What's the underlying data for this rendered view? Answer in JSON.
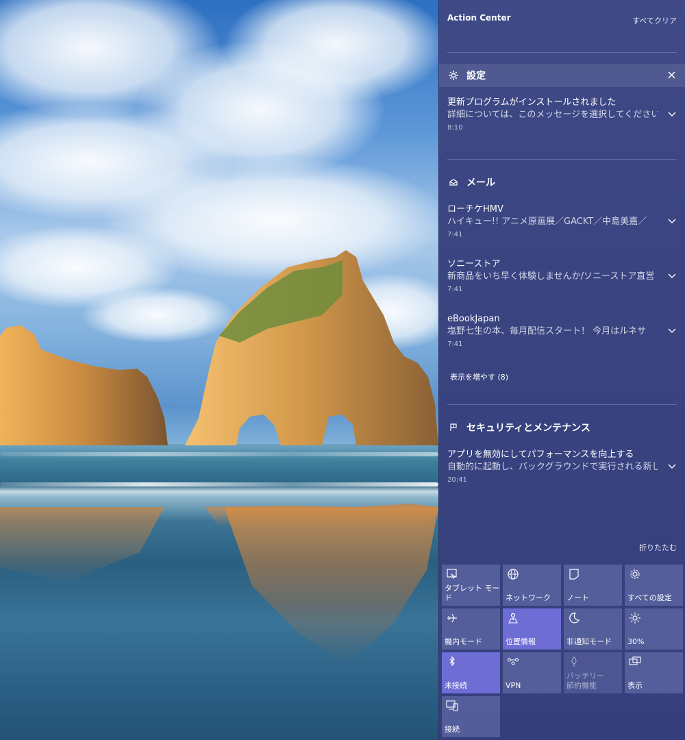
{
  "action_center": {
    "title": "Action Center",
    "clear_all": "すべてクリア",
    "collapse": "折りたたむ",
    "show_more": "表示を増やす (8)"
  },
  "groups": {
    "settings": {
      "title": "設定",
      "icon": "gear-icon",
      "notification": {
        "title": "更新プログラムがインストールされました",
        "body": "詳細については、このメッセージを選択してください。",
        "time": "8:10"
      }
    },
    "mail": {
      "title": "メール",
      "icon": "mail-icon",
      "notifications": [
        {
          "title": "ローチケHMV",
          "body": "ハイキュー!! アニメ原画展／GACKT／中島美嘉／",
          "time": "7:41"
        },
        {
          "title": "ソニーストア",
          "body": "新商品をいち早く体験しませんか/ソニーストア直営",
          "time": "7:41"
        },
        {
          "title": "eBookJapan",
          "body": "塩野七生の本、毎月配信スタート！ 今月はルネサ",
          "time": "7:41"
        }
      ]
    },
    "security": {
      "title": "セキュリティとメンテナンス",
      "icon": "flag-icon",
      "notification": {
        "title": "アプリを無効にしてパフォーマンスを向上する",
        "body": "自動的に起動し、バックグラウンドで実行される新し",
        "time": "20:41"
      }
    }
  },
  "quick_actions": [
    {
      "label": "タブレット モード",
      "icon": "tablet-mode-icon",
      "state": "off"
    },
    {
      "label": "ネットワーク",
      "icon": "globe-icon",
      "state": "off"
    },
    {
      "label": "ノート",
      "icon": "note-icon",
      "state": "off"
    },
    {
      "label": "すべての設定",
      "icon": "gear-icon",
      "state": "off"
    },
    {
      "label": "機内モード",
      "icon": "airplane-icon",
      "state": "off"
    },
    {
      "label": "位置情報",
      "icon": "location-icon",
      "state": "on"
    },
    {
      "label": "非通知モード",
      "icon": "moon-icon",
      "state": "off"
    },
    {
      "label": "30%",
      "icon": "brightness-icon",
      "state": "off"
    },
    {
      "label": "未接続",
      "icon": "bluetooth-icon",
      "state": "on"
    },
    {
      "label": "VPN",
      "icon": "vpn-icon",
      "state": "off"
    },
    {
      "label": "バッテリー\n節約機能",
      "icon": "battery-saver-icon",
      "state": "disabled"
    },
    {
      "label": "表示",
      "icon": "project-icon",
      "state": "off"
    },
    {
      "label": "接続",
      "icon": "connect-icon",
      "state": "off"
    }
  ],
  "colors": {
    "panel_bg": "#3a4581",
    "tile_bg": "#6f78b8",
    "tile_active": "#6e6dd6"
  }
}
